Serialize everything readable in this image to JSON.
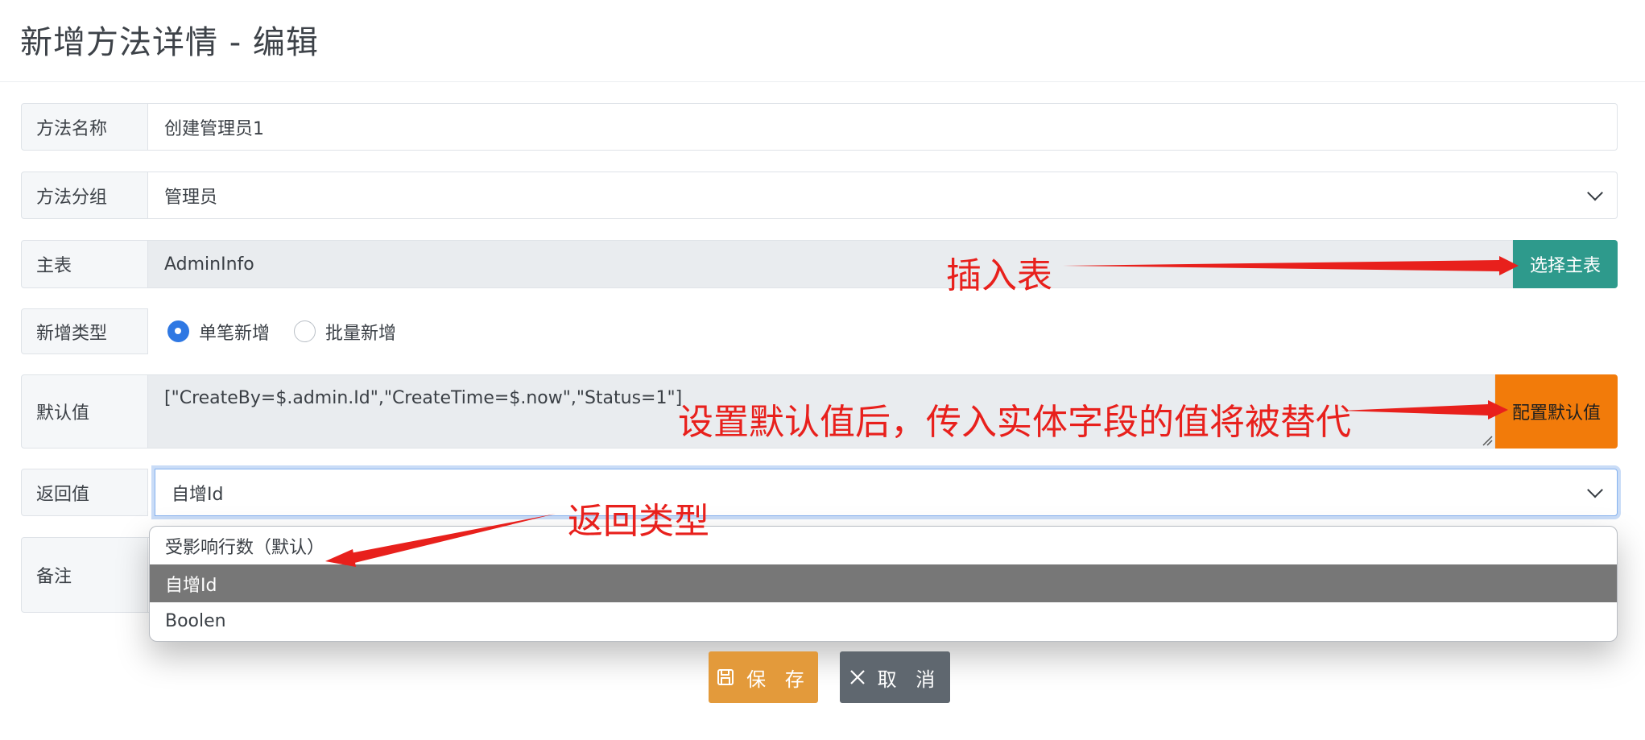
{
  "page": {
    "title": "新增方法详情 - 编辑"
  },
  "form": {
    "method_name": {
      "label": "方法名称",
      "value": "创建管理员1"
    },
    "method_group": {
      "label": "方法分组",
      "value": "管理员"
    },
    "main_table": {
      "label": "主表",
      "value": "AdminInfo",
      "button": "选择主表"
    },
    "insert_type": {
      "label": "新增类型",
      "options": [
        "单笔新增",
        "批量新增"
      ],
      "selected": "单笔新增"
    },
    "default_value": {
      "label": "默认值",
      "value": "[\"CreateBy=$.admin.Id\",\"CreateTime=$.now\",\"Status=1\"]",
      "button": "配置默认值"
    },
    "return_value": {
      "label": "返回值",
      "value": "自增Id",
      "options": [
        "受影响行数（默认）",
        "自增Id",
        "Boolen"
      ]
    },
    "remark": {
      "label": "备注"
    }
  },
  "actions": {
    "save": "保 存",
    "cancel": "取 消"
  },
  "annotations": {
    "insert_table": "插入表",
    "default_value_note": "设置默认值后，传入实体字段的值将被替代",
    "return_type": "返回类型"
  },
  "colors": {
    "teal_button": "#2e9a8c",
    "orange_button": "#f27b0a",
    "save_button": "#e39a3b",
    "cancel_button": "#5f676f",
    "annotation_red": "#e8201c",
    "selected_option": "#777777"
  }
}
